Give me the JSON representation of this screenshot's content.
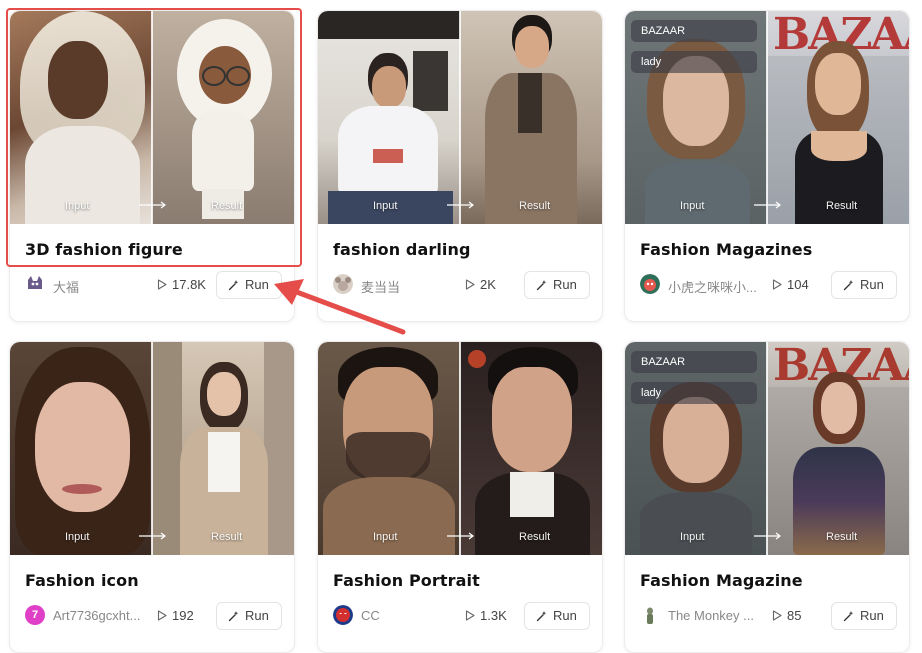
{
  "io_labels": {
    "input": "Input",
    "result": "Result"
  },
  "tags": {
    "bazaar": "BAZAAR",
    "lady": "lady"
  },
  "colors": {
    "highlight": "#e54d4a",
    "arrow": "#e54d4a"
  },
  "cards": [
    {
      "title": "3D fashion figure",
      "author": "大福",
      "plays": "17.8K",
      "run": "Run",
      "avatar_icon": "cat-avatar-icon"
    },
    {
      "title": "fashion darling",
      "author": "麦当当",
      "plays": "2K",
      "run": "Run",
      "avatar_icon": "mouse-avatar-icon"
    },
    {
      "title": "Fashion Magazines",
      "author": "小虎之咪咪小...",
      "plays": "104",
      "run": "Run",
      "avatar_icon": "sticker-avatar-icon"
    },
    {
      "title": "Fashion icon",
      "author": "Art7736gcxht...",
      "plays": "192",
      "run": "Run",
      "avatar_icon": "letter-avatar",
      "avatar_letter": "7"
    },
    {
      "title": "Fashion Portrait",
      "author": "CC",
      "plays": "1.3K",
      "run": "Run",
      "avatar_icon": "spiderman-avatar-icon"
    },
    {
      "title": "Fashion Magazine",
      "author": "The Monkey ...",
      "plays": "85",
      "run": "Run",
      "avatar_icon": "monkey-avatar-icon"
    }
  ]
}
